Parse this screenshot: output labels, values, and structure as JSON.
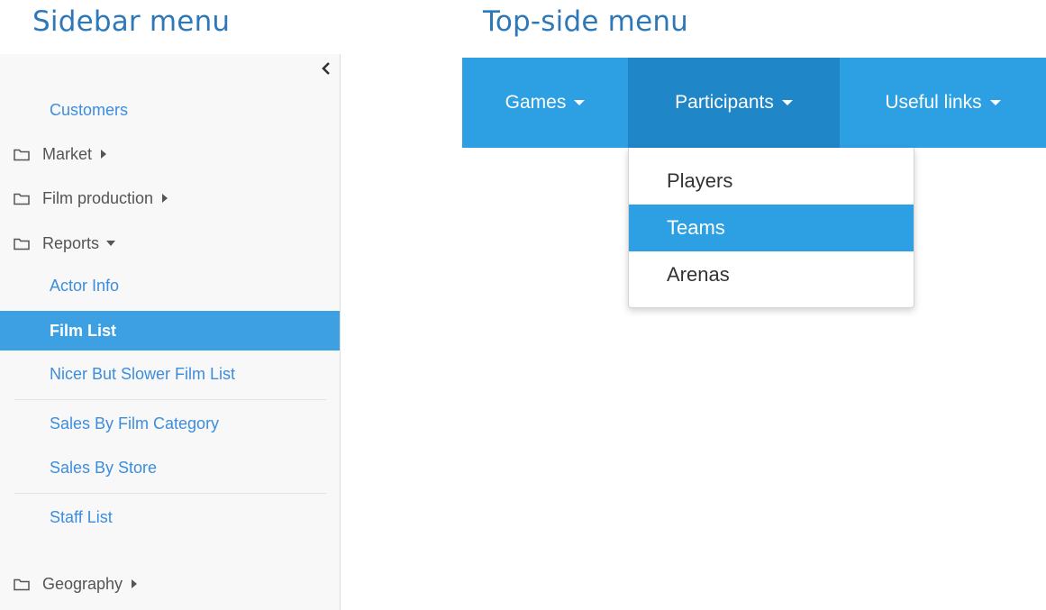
{
  "headings": {
    "sidebar": "Sidebar menu",
    "topside": "Top-side menu"
  },
  "sidebar": {
    "collapse_icon": "chevron-left-icon",
    "items": [
      {
        "type": "link",
        "label": "Customers"
      },
      {
        "type": "folder",
        "label": "Market",
        "state": "collapsed"
      },
      {
        "type": "folder",
        "label": "Film production",
        "state": "collapsed"
      },
      {
        "type": "folder",
        "label": "Reports",
        "state": "expanded"
      },
      {
        "type": "link",
        "label": "Actor Info"
      },
      {
        "type": "link",
        "label": "Film List",
        "active": true
      },
      {
        "type": "link",
        "label": "Nicer But Slower Film List"
      },
      {
        "type": "link",
        "label": "Sales By Film Category"
      },
      {
        "type": "link",
        "label": "Sales By Store"
      },
      {
        "type": "link",
        "label": "Staff List"
      },
      {
        "type": "folder",
        "label": "Geography",
        "state": "collapsed"
      }
    ]
  },
  "topmenu": {
    "items": [
      {
        "label": "Games"
      },
      {
        "label": "Participants",
        "active": true
      },
      {
        "label": "Useful links"
      }
    ],
    "dropdown": [
      {
        "label": "Players"
      },
      {
        "label": "Teams",
        "active": true
      },
      {
        "label": "Arenas"
      }
    ]
  },
  "colors": {
    "heading": "#2e78b7",
    "link": "#3c8dde",
    "active_bg": "#3da0e3",
    "navbar_bg": "#2d9fe3",
    "navbar_active_bg": "#1f86c7",
    "sidebar_bg": "#f8f8f8"
  }
}
